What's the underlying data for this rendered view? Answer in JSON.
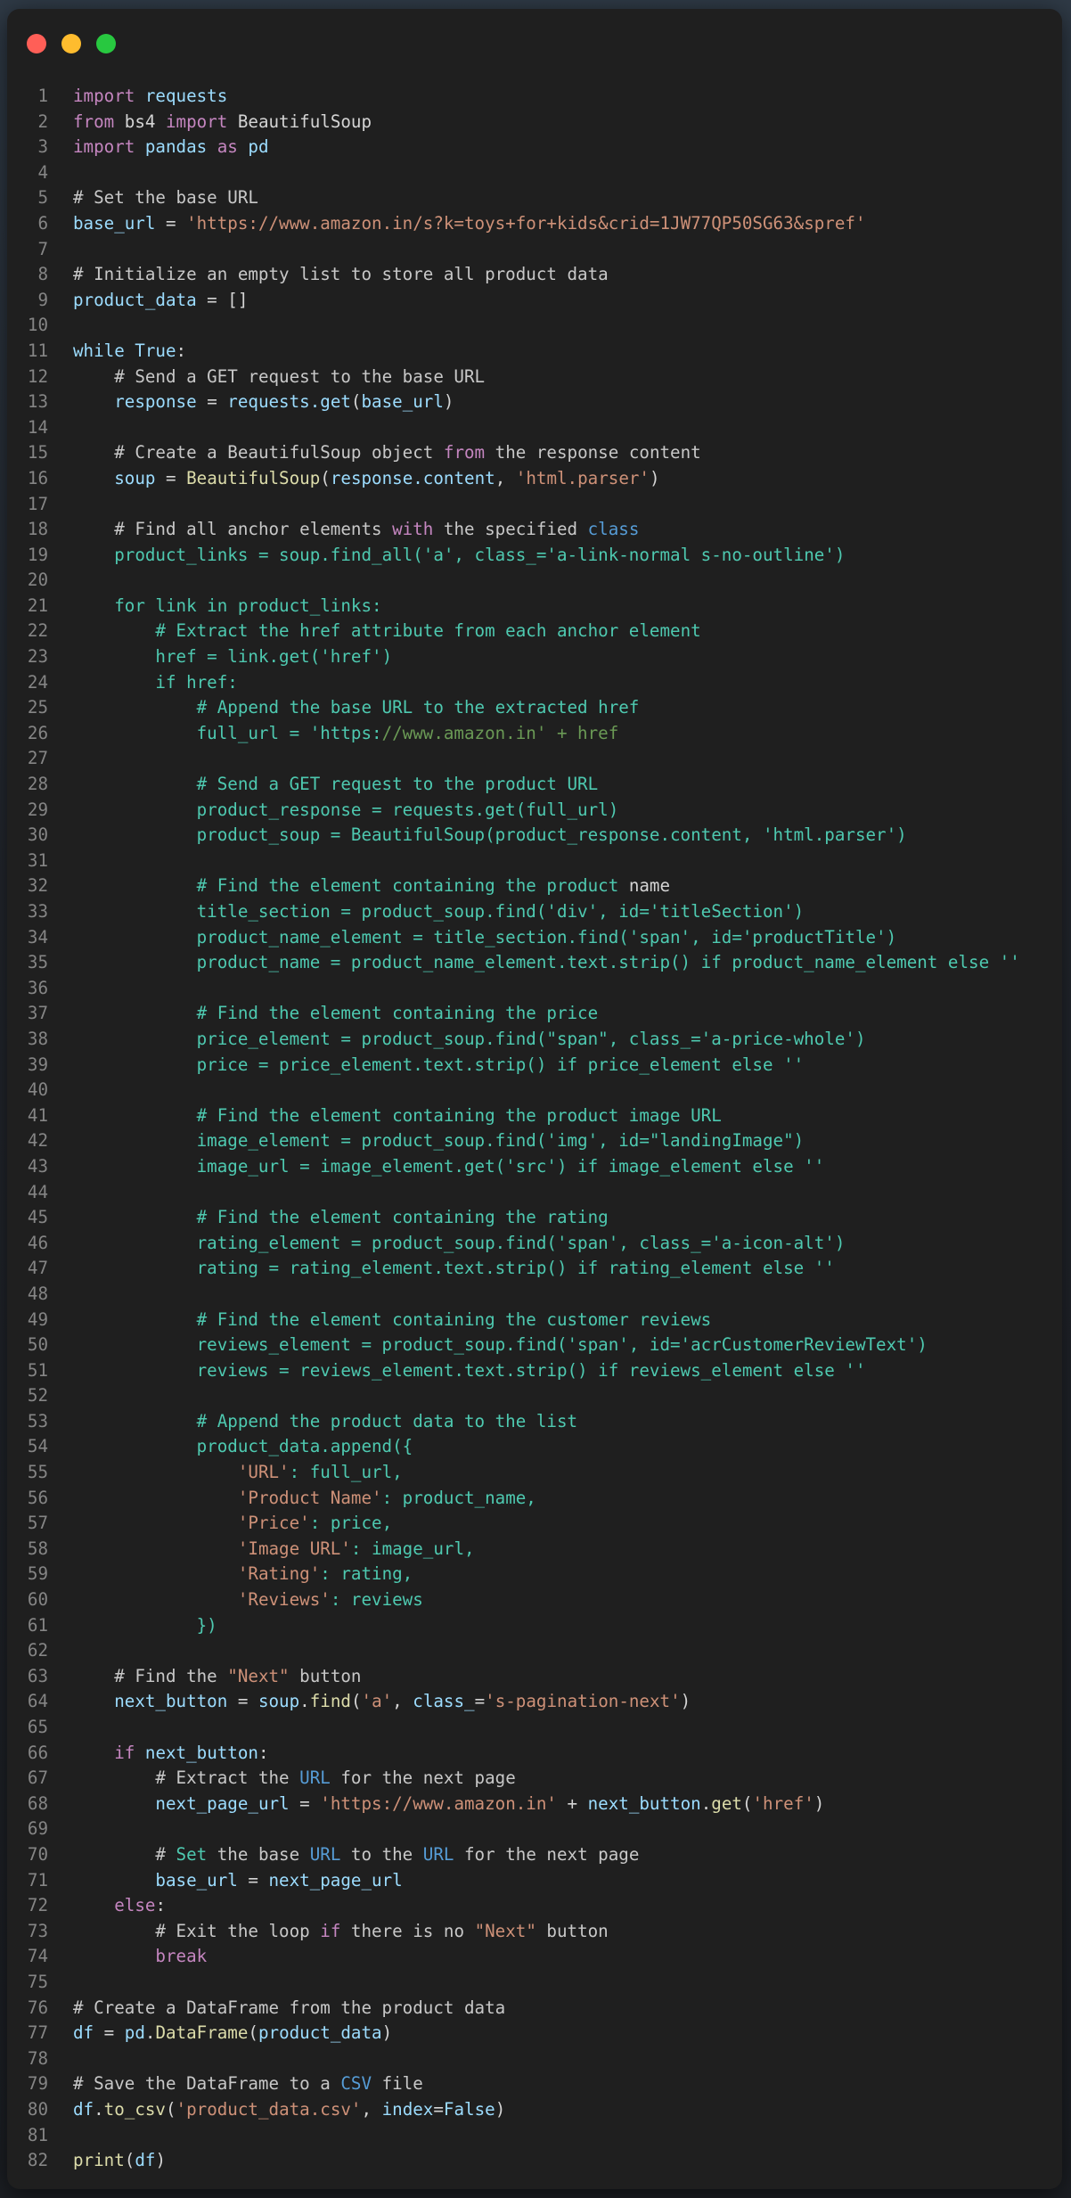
{
  "colors": {
    "window_bg": "#1f1f1f",
    "dot_red": "#ff5f57",
    "dot_yellow": "#febc2e",
    "dot_green": "#28c840"
  },
  "lines": [
    [
      [
        "kw",
        "import"
      ],
      [
        "plain",
        " "
      ],
      [
        "var",
        "requests"
      ]
    ],
    [
      [
        "kw",
        "from"
      ],
      [
        "plain",
        " bs4 "
      ],
      [
        "kw",
        "import"
      ],
      [
        "plain",
        " BeautifulSoup"
      ]
    ],
    [
      [
        "kw",
        "import"
      ],
      [
        "plain",
        " "
      ],
      [
        "var",
        "pandas"
      ],
      [
        "plain",
        " "
      ],
      [
        "kw",
        "as"
      ],
      [
        "plain",
        " "
      ],
      [
        "var",
        "pd"
      ]
    ],
    [],
    [
      [
        "cmt2",
        "# Set the base URL"
      ]
    ],
    [
      [
        "var",
        "base_url"
      ],
      [
        "plain",
        " = "
      ],
      [
        "str",
        "'https://www.amazon.in/s?k=toys+for+kids&crid=1JW77QP50SG63&spref'"
      ]
    ],
    [],
    [
      [
        "cmt2",
        "# Initialize an empty list to store all product data"
      ]
    ],
    [
      [
        "var",
        "product_data"
      ],
      [
        "plain",
        " = []"
      ]
    ],
    [],
    [
      [
        "var",
        "while True"
      ],
      [
        "plain",
        ":"
      ]
    ],
    [
      [
        "plain",
        "    "
      ],
      [
        "cmt2",
        "# Send a GET request to the base URL"
      ]
    ],
    [
      [
        "plain",
        "    "
      ],
      [
        "var",
        "response"
      ],
      [
        "plain",
        " = "
      ],
      [
        "var",
        "requests.get"
      ],
      [
        "plain",
        "("
      ],
      [
        "var",
        "base_url"
      ],
      [
        "plain",
        ")"
      ]
    ],
    [],
    [
      [
        "plain",
        "    "
      ],
      [
        "cmt2",
        "# Create a BeautifulSoup object "
      ],
      [
        "kw",
        "from"
      ],
      [
        "cmt2",
        " the response content"
      ]
    ],
    [
      [
        "plain",
        "    "
      ],
      [
        "var",
        "soup"
      ],
      [
        "plain",
        " = "
      ],
      [
        "fn",
        "BeautifulSoup"
      ],
      [
        "plain",
        "("
      ],
      [
        "var",
        "response.content"
      ],
      [
        "plain",
        ", "
      ],
      [
        "str",
        "'html.parser'"
      ],
      [
        "plain",
        ")"
      ]
    ],
    [],
    [
      [
        "plain",
        "    "
      ],
      [
        "cmt2",
        "# Find all anchor elements "
      ],
      [
        "kw",
        "with"
      ],
      [
        "cmt2",
        " the specified "
      ],
      [
        "blue",
        "class"
      ]
    ],
    [
      [
        "plain",
        "    "
      ],
      [
        "teal",
        "product_links = soup.find_all('a', class_='a-link-normal s-no-outline')"
      ]
    ],
    [],
    [
      [
        "plain",
        "    "
      ],
      [
        "teal",
        "for link in product_links:"
      ]
    ],
    [
      [
        "plain",
        "        "
      ],
      [
        "teal",
        "# Extract the href attribute from each anchor element"
      ]
    ],
    [
      [
        "plain",
        "        "
      ],
      [
        "teal",
        "href = link.get('href')"
      ]
    ],
    [
      [
        "plain",
        "        "
      ],
      [
        "teal",
        "if href:"
      ]
    ],
    [
      [
        "plain",
        "            "
      ],
      [
        "teal",
        "# Append the base URL to the extracted href"
      ]
    ],
    [
      [
        "plain",
        "            "
      ],
      [
        "teal",
        "full_url = 'https:"
      ],
      [
        "cmt",
        "//www.amazon.in' + href"
      ]
    ],
    [],
    [
      [
        "plain",
        "            "
      ],
      [
        "teal",
        "# Send a GET request to the product URL"
      ]
    ],
    [
      [
        "plain",
        "            "
      ],
      [
        "teal",
        "product_response = requests.get(full_url)"
      ]
    ],
    [
      [
        "plain",
        "            "
      ],
      [
        "teal",
        "product_soup = BeautifulSoup(product_response.content, 'html.parser')"
      ]
    ],
    [],
    [
      [
        "plain",
        "            "
      ],
      [
        "teal",
        "# Find the element containing the product "
      ],
      [
        "plain",
        "name"
      ]
    ],
    [
      [
        "plain",
        "            "
      ],
      [
        "teal",
        "title_section = product_soup.find('div', id='titleSection')"
      ]
    ],
    [
      [
        "plain",
        "            "
      ],
      [
        "teal",
        "product_name_element = title_section.find('span', id='productTitle')"
      ]
    ],
    [
      [
        "plain",
        "            "
      ],
      [
        "teal",
        "product_name = product_name_element.text.strip() if product_name_element else ''"
      ]
    ],
    [],
    [
      [
        "plain",
        "            "
      ],
      [
        "teal",
        "# Find the element containing the price"
      ]
    ],
    [
      [
        "plain",
        "            "
      ],
      [
        "teal",
        "price_element = product_soup.find(\"span\", class_='a-price-whole')"
      ]
    ],
    [
      [
        "plain",
        "            "
      ],
      [
        "teal",
        "price = price_element.text.strip() if price_element else ''"
      ]
    ],
    [],
    [
      [
        "plain",
        "            "
      ],
      [
        "teal",
        "# Find the element containing the product image URL"
      ]
    ],
    [
      [
        "plain",
        "            "
      ],
      [
        "teal",
        "image_element = product_soup.find('img', id=\"landingImage\")"
      ]
    ],
    [
      [
        "plain",
        "            "
      ],
      [
        "teal",
        "image_url = image_element.get('src') if image_element else ''"
      ]
    ],
    [],
    [
      [
        "plain",
        "            "
      ],
      [
        "teal",
        "# Find the element containing the rating"
      ]
    ],
    [
      [
        "plain",
        "            "
      ],
      [
        "teal",
        "rating_element = product_soup.find('span', class_='a-icon-alt')"
      ]
    ],
    [
      [
        "plain",
        "            "
      ],
      [
        "teal",
        "rating = rating_element.text.strip() if rating_element else ''"
      ]
    ],
    [],
    [
      [
        "plain",
        "            "
      ],
      [
        "teal",
        "# Find the element containing the customer reviews"
      ]
    ],
    [
      [
        "plain",
        "            "
      ],
      [
        "teal",
        "reviews_element = product_soup.find('span', id='acrCustomerReviewText')"
      ]
    ],
    [
      [
        "plain",
        "            "
      ],
      [
        "teal",
        "reviews = reviews_element.text.strip() if reviews_element else ''"
      ]
    ],
    [],
    [
      [
        "plain",
        "            "
      ],
      [
        "teal",
        "# Append the product data to the list"
      ]
    ],
    [
      [
        "plain",
        "            "
      ],
      [
        "teal",
        "product_data.append({"
      ]
    ],
    [
      [
        "plain",
        "                "
      ],
      [
        "str",
        "'URL'"
      ],
      [
        "teal",
        ": full_url,"
      ]
    ],
    [
      [
        "plain",
        "                "
      ],
      [
        "str",
        "'Product Name'"
      ],
      [
        "teal",
        ": product_name,"
      ]
    ],
    [
      [
        "plain",
        "                "
      ],
      [
        "str",
        "'Price'"
      ],
      [
        "teal",
        ": price,"
      ]
    ],
    [
      [
        "plain",
        "                "
      ],
      [
        "str",
        "'Image URL'"
      ],
      [
        "teal",
        ": image_url,"
      ]
    ],
    [
      [
        "plain",
        "                "
      ],
      [
        "str",
        "'Rating'"
      ],
      [
        "teal",
        ": rating,"
      ]
    ],
    [
      [
        "plain",
        "                "
      ],
      [
        "str",
        "'Reviews'"
      ],
      [
        "teal",
        ": reviews"
      ]
    ],
    [
      [
        "plain",
        "            "
      ],
      [
        "teal",
        "})"
      ]
    ],
    [],
    [
      [
        "plain",
        "    "
      ],
      [
        "cmt2",
        "# Find the "
      ],
      [
        "str",
        "\"Next\""
      ],
      [
        "cmt2",
        " button"
      ]
    ],
    [
      [
        "plain",
        "    "
      ],
      [
        "var",
        "next_button"
      ],
      [
        "plain",
        " = "
      ],
      [
        "var",
        "soup"
      ],
      [
        "plain",
        "."
      ],
      [
        "fn",
        "find"
      ],
      [
        "plain",
        "("
      ],
      [
        "str",
        "'a'"
      ],
      [
        "plain",
        ", "
      ],
      [
        "var",
        "class_"
      ],
      [
        "plain",
        "="
      ],
      [
        "str",
        "'s-pagination-next'"
      ],
      [
        "plain",
        ")"
      ]
    ],
    [],
    [
      [
        "plain",
        "    "
      ],
      [
        "kw",
        "if"
      ],
      [
        "plain",
        " "
      ],
      [
        "var",
        "next_button"
      ],
      [
        "plain",
        ":"
      ]
    ],
    [
      [
        "plain",
        "        "
      ],
      [
        "cmt2",
        "# Extract the "
      ],
      [
        "blue",
        "URL"
      ],
      [
        "cmt2",
        " for the next page"
      ]
    ],
    [
      [
        "plain",
        "        "
      ],
      [
        "var",
        "next_page_url"
      ],
      [
        "plain",
        " = "
      ],
      [
        "str",
        "'https://www.amazon.in'"
      ],
      [
        "plain",
        " + "
      ],
      [
        "var",
        "next_button"
      ],
      [
        "plain",
        "."
      ],
      [
        "fn",
        "get"
      ],
      [
        "plain",
        "("
      ],
      [
        "str",
        "'href'"
      ],
      [
        "plain",
        ")"
      ]
    ],
    [],
    [
      [
        "plain",
        "        "
      ],
      [
        "cmt2",
        "# "
      ],
      [
        "teal",
        "Set"
      ],
      [
        "cmt2",
        " the base "
      ],
      [
        "blue",
        "URL"
      ],
      [
        "cmt2",
        " to the "
      ],
      [
        "blue",
        "URL"
      ],
      [
        "cmt2",
        " for the next page"
      ]
    ],
    [
      [
        "plain",
        "        "
      ],
      [
        "var",
        "base_url"
      ],
      [
        "plain",
        " = "
      ],
      [
        "var",
        "next_page_url"
      ]
    ],
    [
      [
        "plain",
        "    "
      ],
      [
        "kw",
        "else"
      ],
      [
        "plain",
        ":"
      ]
    ],
    [
      [
        "plain",
        "        "
      ],
      [
        "cmt2",
        "# Exit the loop "
      ],
      [
        "kw",
        "if"
      ],
      [
        "cmt2",
        " there is no "
      ],
      [
        "str",
        "\"Next\""
      ],
      [
        "cmt2",
        " button"
      ]
    ],
    [
      [
        "plain",
        "        "
      ],
      [
        "kw",
        "break"
      ]
    ],
    [],
    [
      [
        "cmt2",
        "# Create a DataFrame from the product data"
      ]
    ],
    [
      [
        "var",
        "df"
      ],
      [
        "plain",
        " = "
      ],
      [
        "var",
        "pd"
      ],
      [
        "plain",
        "."
      ],
      [
        "fn",
        "DataFrame"
      ],
      [
        "plain",
        "("
      ],
      [
        "var",
        "product_data"
      ],
      [
        "plain",
        ")"
      ]
    ],
    [],
    [
      [
        "cmt2",
        "# Save the DataFrame to a "
      ],
      [
        "blue",
        "CSV"
      ],
      [
        "cmt2",
        " file"
      ]
    ],
    [
      [
        "var",
        "df"
      ],
      [
        "plain",
        "."
      ],
      [
        "fn",
        "to_csv"
      ],
      [
        "plain",
        "("
      ],
      [
        "str",
        "'product_data.csv'"
      ],
      [
        "plain",
        ", "
      ],
      [
        "var",
        "index"
      ],
      [
        "plain",
        "="
      ],
      [
        "var",
        "False"
      ],
      [
        "plain",
        ")"
      ]
    ],
    [],
    [
      [
        "fn",
        "print"
      ],
      [
        "plain",
        "("
      ],
      [
        "var",
        "df"
      ],
      [
        "plain",
        ")"
      ]
    ]
  ]
}
